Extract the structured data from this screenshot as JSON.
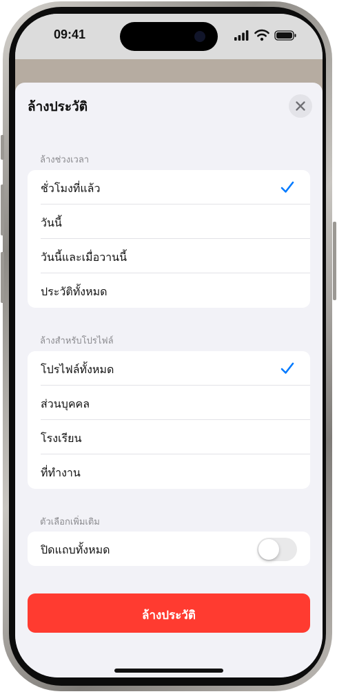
{
  "status_bar": {
    "time": "09:41"
  },
  "sheet": {
    "title": "ล้างประวัติ",
    "close_icon": "close-icon"
  },
  "time_range": {
    "header": "ล้างช่วงเวลา",
    "items": [
      {
        "label": "ชั่วโมงที่แล้ว",
        "selected": true
      },
      {
        "label": "วันนี้",
        "selected": false
      },
      {
        "label": "วันนี้และเมื่อวานนี้",
        "selected": false
      },
      {
        "label": "ประวัติทั้งหมด",
        "selected": false
      }
    ]
  },
  "profiles": {
    "header": "ล้างสำหรับโปรไฟล์",
    "items": [
      {
        "label": "โปรไฟล์ทั้งหมด",
        "selected": true
      },
      {
        "label": "ส่วนบุคคล",
        "selected": false
      },
      {
        "label": "โรงเรียน",
        "selected": false
      },
      {
        "label": "ที่ทำงาน",
        "selected": false
      }
    ]
  },
  "options": {
    "header": "ตัวเลือกเพิ่มเติม",
    "close_tabs_label": "ปิดแถบทั้งหมด",
    "close_tabs_on": false
  },
  "primary_button": {
    "label": "ล้างประวัติ"
  },
  "colors": {
    "accent": "#007aff",
    "destructive": "#ff3b30",
    "sheet_background": "#f2f2f7"
  }
}
